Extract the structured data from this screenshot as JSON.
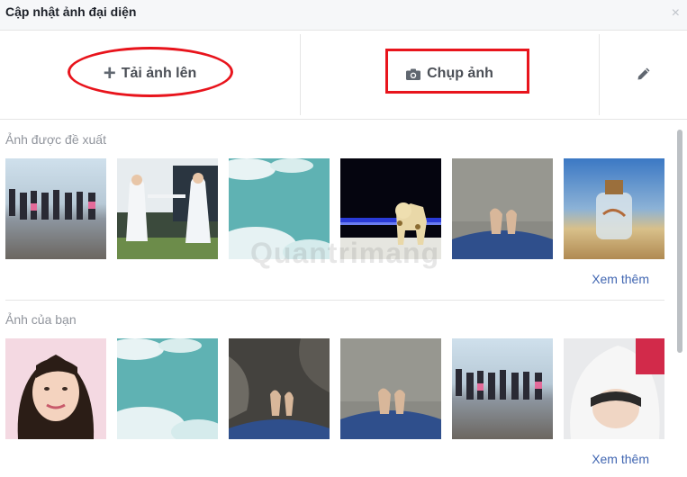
{
  "dialog": {
    "title": "Cập nhật ảnh đại diện",
    "close_icon": "×"
  },
  "actions": {
    "upload_label": "Tải ảnh lên",
    "camera_label": "Chụp ảnh"
  },
  "sections": {
    "suggested": {
      "label": "Ảnh được đề xuất",
      "more_label": "Xem thêm"
    },
    "yours": {
      "label": "Ảnh của bạn",
      "more_label": "Xem thêm"
    }
  },
  "watermark": "Quantrimang",
  "colors": {
    "highlight": "#e8141c",
    "link": "#4267b2"
  }
}
